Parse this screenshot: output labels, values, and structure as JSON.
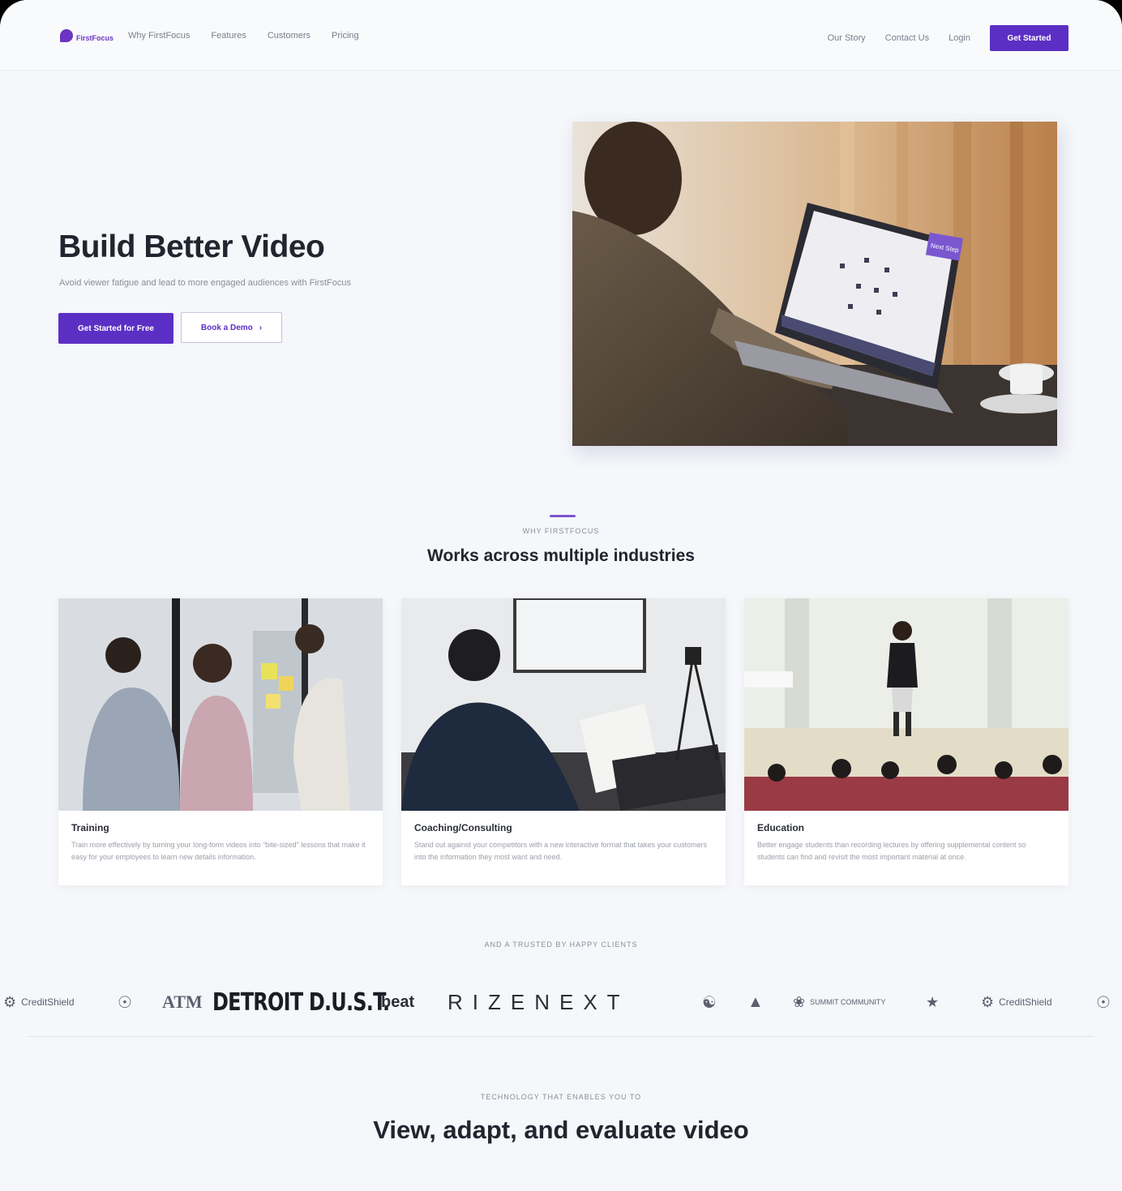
{
  "nav": {
    "logo_text": "FirstFocus",
    "links": [
      "Why FirstFocus",
      "Features",
      "Customers",
      "Pricing"
    ],
    "right_links": [
      "Our Story",
      "Contact Us",
      "Login"
    ],
    "cta": "Get Started"
  },
  "hero": {
    "title": "Build Better Video",
    "subtitle": "Avoid viewer fatigue and lead to more engaged audiences with FirstFocus",
    "primary_button": "Get Started for Free",
    "secondary_button": "Book a Demo",
    "laptop_badge": "Next Step"
  },
  "industries": {
    "eyebrow": "WHY FIRSTFOCUS",
    "title": "Works across multiple industries",
    "cards": [
      {
        "title": "Training",
        "text": "Train more effectively by turning your long-form videos into “bite-sized” lessons that make it easy for your employees to learn new details information."
      },
      {
        "title": "Coaching/Consulting",
        "text": "Stand out against your competitors with a new interactive format that takes your customers into the information they most want and need."
      },
      {
        "title": "Education",
        "text": "Better engage students than recording lectures by offering supplemental content so students can find and revisit the most important material at once."
      }
    ]
  },
  "clients": {
    "eyebrow": "AND A TRUSTED BY HAPPY CLIENTS",
    "logos": [
      "CreditShield",
      "ATM",
      "DETROIT D.U.S.T.",
      "beat",
      "RIZENEXT",
      "SUMMIT COMMUNITY",
      "CreditShield"
    ]
  },
  "features": {
    "eyebrow": "TECHNOLOGY THAT ENABLES YOU TO",
    "title": "View, adapt, and evaluate video"
  },
  "colors": {
    "accent": "#5b2fc4",
    "background": "#f5f7fa"
  }
}
